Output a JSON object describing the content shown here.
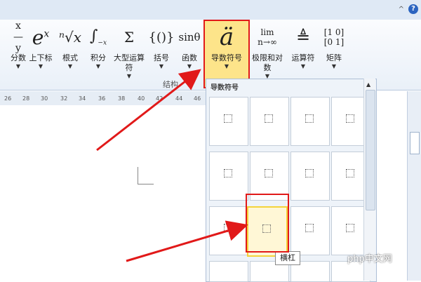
{
  "ribbon": {
    "buttons": [
      {
        "name": "fraction-button",
        "symbol": "x/y",
        "label": "分数"
      },
      {
        "name": "script-button",
        "symbol": "eˣ",
        "label": "上下标"
      },
      {
        "name": "radical-button",
        "symbol": "ⁿ√x",
        "label": "根式"
      },
      {
        "name": "integral-button",
        "symbol": "∫",
        "label": "积分"
      },
      {
        "name": "large-operator-button",
        "symbol": "Σ",
        "label": "大型运算符"
      },
      {
        "name": "bracket-button",
        "symbol": "{()}",
        "label": "括号"
      },
      {
        "name": "function-button",
        "symbol": "sinθ",
        "label": "函数"
      },
      {
        "name": "accent-button",
        "symbol": "ä",
        "label": "导数符号"
      },
      {
        "name": "limit-log-button",
        "symbol": "lim n→∞",
        "label": "极限和对数"
      },
      {
        "name": "operator-button",
        "symbol": "≜",
        "label": "运算符"
      },
      {
        "name": "matrix-button",
        "symbol": "[10 01]",
        "label": "矩阵"
      }
    ],
    "group_label": "结构"
  },
  "ruler": {
    "ticks": [
      "26",
      "28",
      "30",
      "32",
      "34",
      "36",
      "38",
      "40",
      "42",
      "44",
      "46"
    ]
  },
  "accent_panel": {
    "title": "导数符号",
    "tooltip": "横杠"
  },
  "watermark": "php中文网",
  "colors": {
    "highlight_red": "#e11919",
    "selected_tile_yellow": "#f4d33b"
  }
}
